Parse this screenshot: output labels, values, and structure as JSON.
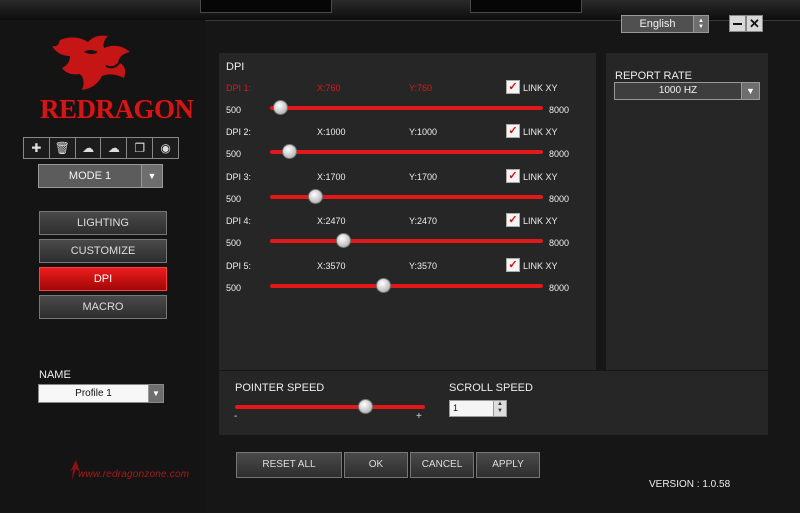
{
  "app": {
    "brand": "REDRAGON",
    "url": "www.redragonzone.com",
    "version": "VERSION : 1.0.58"
  },
  "colors": {
    "accent": "#e31818",
    "panel": "#262626",
    "background": "#161616"
  },
  "language": {
    "value": "English"
  },
  "window_controls": {
    "minimize_icon": "minimize-icon",
    "close_icon": "close-icon",
    "close_glyph": "✕"
  },
  "toolbar": {
    "icons": [
      {
        "name": "add-icon",
        "glyph": "✚"
      },
      {
        "name": "delete-icon",
        "glyph": "🗑"
      },
      {
        "name": "import-icon",
        "glyph": "☁"
      },
      {
        "name": "export-icon",
        "glyph": "☁"
      },
      {
        "name": "copy-icon",
        "glyph": "❐"
      },
      {
        "name": "palette-icon",
        "glyph": "◉"
      }
    ]
  },
  "mode": {
    "value": "MODE 1"
  },
  "nav": {
    "items": [
      {
        "label": "LIGHTING",
        "active": false
      },
      {
        "label": "CUSTOMIZE",
        "active": false
      },
      {
        "label": "DPI",
        "active": true
      },
      {
        "label": "MACRO",
        "active": false
      }
    ]
  },
  "profile": {
    "label": "NAME",
    "value": "Profile 1"
  },
  "dpi": {
    "title": "DPI",
    "min_label": "500",
    "max_label": "8000",
    "link_label": "LINK XY",
    "min": 500,
    "max": 8000,
    "rows": [
      {
        "label": "DPI 1:",
        "x": "X:760",
        "y": "Y:760",
        "value": 760,
        "linked": true,
        "active": true
      },
      {
        "label": "DPI 2:",
        "x": "X:1000",
        "y": "Y:1000",
        "value": 1000,
        "linked": true,
        "active": false
      },
      {
        "label": "DPI 3:",
        "x": "X:1700",
        "y": "Y:1700",
        "value": 1700,
        "linked": true,
        "active": false
      },
      {
        "label": "DPI 4:",
        "x": "X:2470",
        "y": "Y:2470",
        "value": 2470,
        "linked": true,
        "active": false
      },
      {
        "label": "DPI 5:",
        "x": "X:3570",
        "y": "Y:3570",
        "value": 3570,
        "linked": true,
        "active": false
      }
    ]
  },
  "report_rate": {
    "title": "REPORT RATE",
    "value": "1000 HZ"
  },
  "pointer_speed": {
    "label": "POINTER SPEED",
    "min_label": "-",
    "max_label": "+",
    "level_fraction": 0.68
  },
  "scroll_speed": {
    "label": "SCROLL SPEED",
    "value": "1"
  },
  "actions": {
    "reset": "RESET ALL",
    "ok": "OK",
    "cancel": "CANCEL",
    "apply": "APPLY"
  }
}
